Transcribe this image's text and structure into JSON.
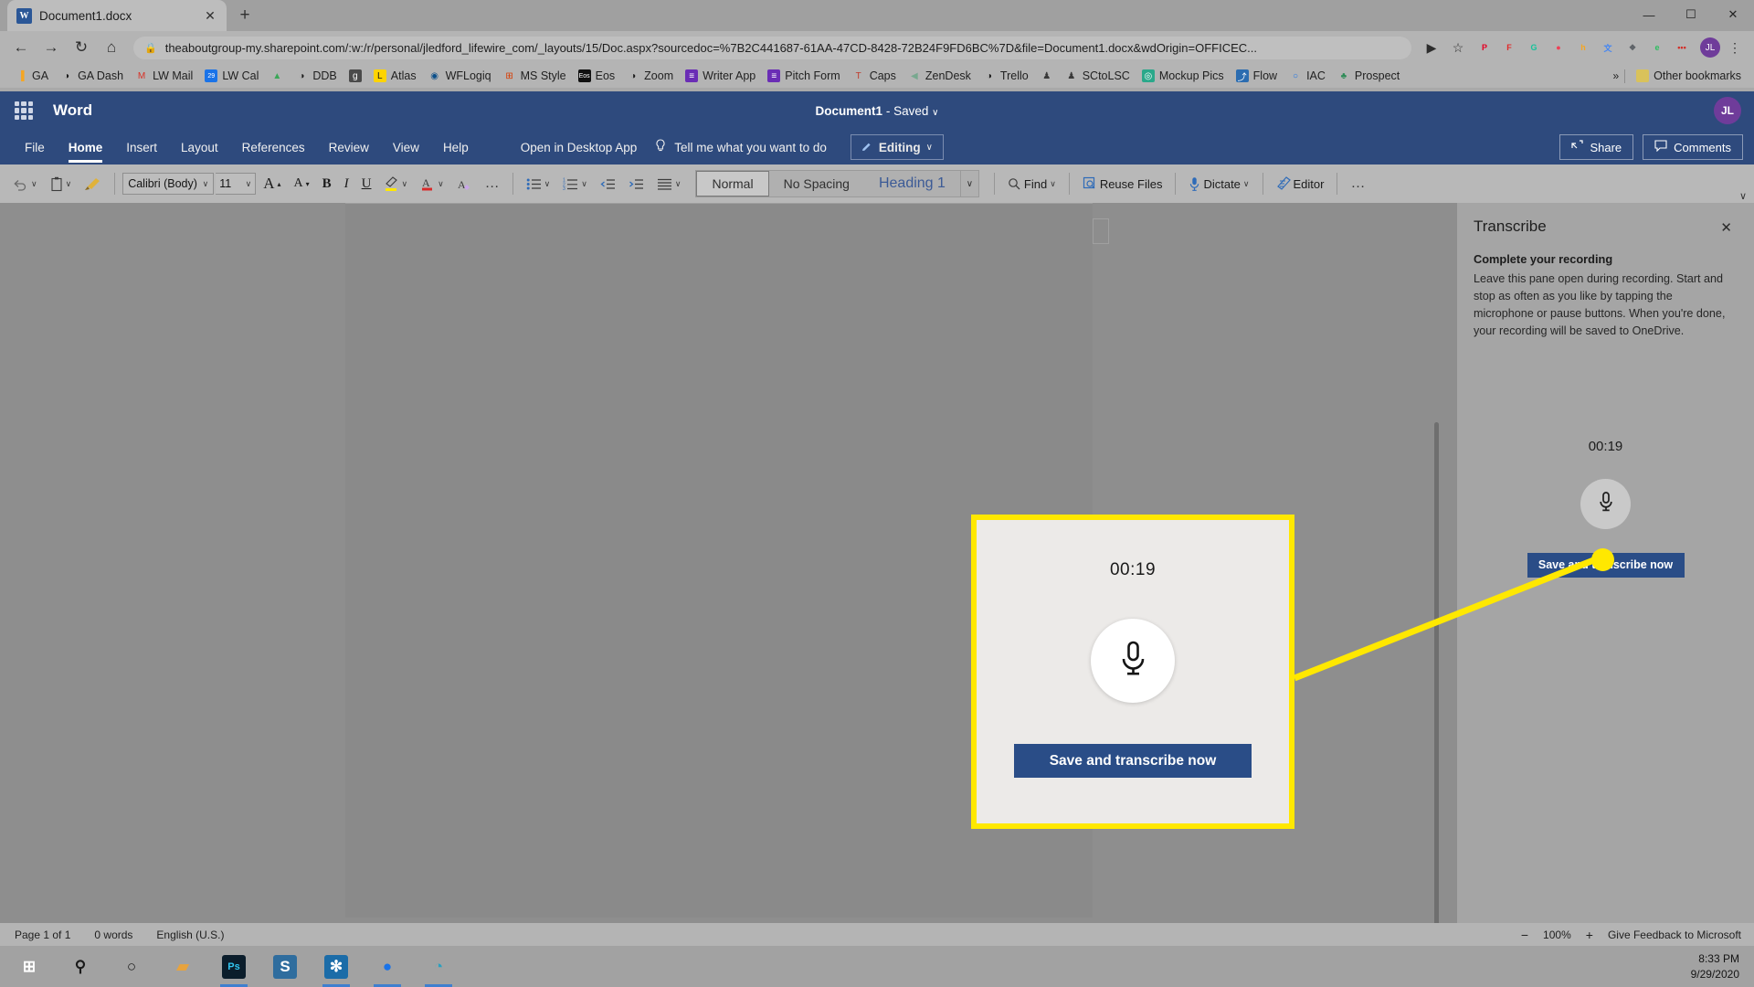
{
  "browser": {
    "tab": {
      "title": "Document1.docx",
      "favicon_label": "W",
      "favicon_name": "word-favicon",
      "close_label": "✕"
    },
    "newtab_label": "+",
    "window_controls": {
      "minimize": "—",
      "maximize": "☐",
      "close": "✕"
    },
    "nav": {
      "back": "←",
      "forward": "→",
      "reload": "↻",
      "home": "⌂"
    },
    "omnibox": {
      "lock": "🔒",
      "url": "theaboutgroup-my.sharepoint.com/:w:/r/personal/jledford_lifewire_com/_layouts/15/Doc.aspx?sourcedoc=%7B2C441687-61AA-47CD-8428-72B24F9FD6BC%7D&file=Document1.docx&wdOrigin=OFFICEC...",
      "media_icon": "▶",
      "star_icon": "☆"
    },
    "extensions": [
      {
        "name": "pinterest-extension",
        "glyph": "P",
        "color": "#e60023"
      },
      {
        "name": "flipboard-extension",
        "glyph": "F",
        "color": "#e12828"
      },
      {
        "name": "grammarly-extension",
        "glyph": "G",
        "color": "#15c39a"
      },
      {
        "name": "pocket-extension",
        "glyph": "●",
        "color": "#ef4056"
      },
      {
        "name": "honey-extension",
        "glyph": "h",
        "color": "#f5a623"
      },
      {
        "name": "translate-extension",
        "glyph": "文",
        "color": "#4285f4"
      },
      {
        "name": "puzzle-extension",
        "glyph": "❖",
        "color": "#5f6368"
      },
      {
        "name": "evernote-extension",
        "glyph": "e",
        "color": "#2dbe60"
      },
      {
        "name": "lastpass-extension",
        "glyph": "•••",
        "color": "#d32d27"
      }
    ],
    "profile_initials": "JL",
    "menu_icon": "⋮",
    "bookmarks": [
      {
        "label": "GA",
        "icon": "bar-chart-icon",
        "glyph": "▐",
        "color": "#f5a623",
        "bg": "transparent"
      },
      {
        "label": "GA Dash",
        "icon": "globe-icon",
        "glyph": "◑",
        "color": "#1a1a1a",
        "bg": "transparent"
      },
      {
        "label": "LW Mail",
        "icon": "gmail-icon",
        "glyph": "M",
        "color": "#d93025",
        "bg": "transparent"
      },
      {
        "label": "LW Cal",
        "icon": "calendar-icon",
        "glyph": "29",
        "color": "#ffffff",
        "bg": "#1a73e8"
      },
      {
        "label": "",
        "icon": "google-drive-icon",
        "glyph": "▲",
        "color": "#3aa757",
        "bg": "transparent"
      },
      {
        "label": "DDB",
        "icon": "globe-icon",
        "glyph": "◑",
        "color": "#1a1a1a",
        "bg": "transparent"
      },
      {
        "label": "",
        "icon": "g-square-icon",
        "glyph": "g",
        "color": "#ffffff",
        "bg": "#4a4a4a"
      },
      {
        "label": "Atlas",
        "icon": "atlas-icon",
        "glyph": "L",
        "color": "#1a1a1a",
        "bg": "#ffd400"
      },
      {
        "label": "WFLogiq",
        "icon": "wflogiq-icon",
        "glyph": "◉",
        "color": "#0b4f8a",
        "bg": "transparent"
      },
      {
        "label": "MS Style",
        "icon": "microsoft-icon",
        "glyph": "⊞",
        "color": "#d83b01",
        "bg": "transparent"
      },
      {
        "label": "Eos",
        "icon": "eos-icon",
        "glyph": "Eos",
        "color": "#ffffff",
        "bg": "#111111"
      },
      {
        "label": "Zoom",
        "icon": "globe-icon",
        "glyph": "◑",
        "color": "#1a1a1a",
        "bg": "transparent"
      },
      {
        "label": "Writer App",
        "icon": "list-icon",
        "glyph": "≡",
        "color": "#ffffff",
        "bg": "#6a2db5"
      },
      {
        "label": "Pitch Form",
        "icon": "list-icon",
        "glyph": "≡",
        "color": "#ffffff",
        "bg": "#6a2db5"
      },
      {
        "label": "Caps",
        "icon": "t-box-icon",
        "glyph": "T",
        "color": "#c0392b",
        "bg": "transparent"
      },
      {
        "label": "ZenDesk",
        "icon": "zendesk-icon",
        "glyph": "◀",
        "color": "#78a88f",
        "bg": "transparent"
      },
      {
        "label": "Trello",
        "icon": "globe-icon",
        "glyph": "◑",
        "color": "#1a1a1a",
        "bg": "transparent"
      },
      {
        "label": "",
        "icon": "person-icon",
        "glyph": "♟",
        "color": "#3a3a3a",
        "bg": "transparent"
      },
      {
        "label": "SCtoLSC",
        "icon": "person-icon",
        "glyph": "♟",
        "color": "#3a3a3a",
        "bg": "transparent"
      },
      {
        "label": "Mockup Pics",
        "icon": "camera-icon",
        "glyph": "◎",
        "color": "#ffffff",
        "bg": "#2aa88a"
      },
      {
        "label": "Flow",
        "icon": "flow-icon",
        "glyph": "⤴",
        "color": "#ffffff",
        "bg": "#2b6cb0"
      },
      {
        "label": "IAC",
        "icon": "circle-icon",
        "glyph": "○",
        "color": "#1a73e8",
        "bg": "transparent"
      },
      {
        "label": "Prospect",
        "icon": "prospect-icon",
        "glyph": "♣",
        "color": "#2e8b57",
        "bg": "transparent"
      }
    ],
    "bookmarks_overflow": "»",
    "other_bookmarks": {
      "label": "Other bookmarks",
      "icon": "folder-icon",
      "glyph": "▮"
    }
  },
  "word": {
    "waffle_name": "app-launcher-icon",
    "brand": "Word",
    "document_title": "Document1",
    "save_state": "Saved",
    "title_dash": "-",
    "title_caret": "∨",
    "avatar_initials": "JL",
    "menu": [
      {
        "label": "File",
        "active": false
      },
      {
        "label": "Home",
        "active": true
      },
      {
        "label": "Insert",
        "active": false
      },
      {
        "label": "Layout",
        "active": false
      },
      {
        "label": "References",
        "active": false
      },
      {
        "label": "Review",
        "active": false
      },
      {
        "label": "View",
        "active": false
      },
      {
        "label": "Help",
        "active": false
      }
    ],
    "open_desktop": "Open in Desktop App",
    "tellme": {
      "label": "Tell me what you want to do",
      "icon": "lightbulb-icon",
      "glyph": "○"
    },
    "editing": {
      "label": "Editing",
      "icon": "pencil-icon",
      "glyph": "✐",
      "caret": "∨"
    },
    "share": {
      "label": "Share",
      "icon": "share-icon",
      "glyph": "⇪"
    },
    "comments": {
      "label": "Comments",
      "icon": "comment-icon",
      "glyph": "▭"
    },
    "ribbon": {
      "undo": {
        "name": "undo-button",
        "glyph": "↶",
        "caret": "∨"
      },
      "paste": {
        "name": "paste-button",
        "glyph": "▧",
        "caret": "∨"
      },
      "format_painter": {
        "name": "format-painter-button",
        "glyph": "✐"
      },
      "font_name": "Calibri (Body)",
      "font_size": "11",
      "grow_font": {
        "name": "grow-font-button",
        "glyph": "A"
      },
      "shrink_font": {
        "name": "shrink-font-button",
        "glyph": "A"
      },
      "bold": "B",
      "italic": "I",
      "underline": "U",
      "highlight": {
        "name": "highlight-color-button",
        "glyph": "✐",
        "caret": "∨",
        "color": "#ffe800"
      },
      "font_color": {
        "name": "font-color-button",
        "glyph": "A",
        "caret": "∨",
        "color": "#d92b2b"
      },
      "clear_format": {
        "name": "clear-formatting-button",
        "glyph": "A"
      },
      "more_font": "…",
      "bullets": {
        "name": "bullet-list-button",
        "glyph": "≣",
        "caret": "∨"
      },
      "numbering": {
        "name": "numbered-list-button",
        "glyph": "≣",
        "caret": "∨"
      },
      "decrease_indent": {
        "name": "decrease-indent-button",
        "glyph": "⤇"
      },
      "increase_indent": {
        "name": "increase-indent-button",
        "glyph": "⤆"
      },
      "align": {
        "name": "align-button",
        "glyph": "≡",
        "caret": "∨"
      },
      "styles": [
        {
          "label": "Normal",
          "selected": true
        },
        {
          "label": "No Spacing",
          "selected": false
        },
        {
          "label": "Heading 1",
          "selected": false
        }
      ],
      "styles_more": "∨",
      "find": {
        "label": "Find",
        "icon": "search-icon",
        "glyph": "⚲",
        "caret": "∨"
      },
      "reuse_files": {
        "label": "Reuse Files",
        "icon": "reuse-files-icon",
        "glyph": "⧉"
      },
      "dictate": {
        "label": "Dictate",
        "icon": "microphone-icon",
        "caret": "∨"
      },
      "editor": {
        "label": "Editor",
        "icon": "editor-icon",
        "glyph": "✒"
      },
      "overflow": "…",
      "collapse": "∨"
    },
    "status": {
      "page": "Page 1 of 1",
      "words": "0 words",
      "language": "English (U.S.)",
      "zoom_out": "−",
      "zoom_level": "100%",
      "zoom_in": "+",
      "feedback": "Give Feedback to Microsoft"
    }
  },
  "transcribe_pane": {
    "title": "Transcribe",
    "close": "✕",
    "subtitle": "Complete your recording",
    "body": "Leave this pane open during recording. Start and stop as often as you like by tapping the microphone or pause buttons. When you're done, your recording will be saved to OneDrive.",
    "timer": "00:19",
    "mic_icon": "microphone-icon",
    "cta": "Save and transcribe now"
  },
  "callout": {
    "timer": "00:19",
    "mic_icon": "microphone-icon",
    "cta": "Save and transcribe now",
    "border_color": "#ffe800"
  },
  "taskbar": {
    "items": [
      {
        "name": "start-button",
        "glyph": "⊞",
        "color": "#ffffff",
        "bg": "transparent",
        "running": false
      },
      {
        "name": "search-icon",
        "glyph": "⚲",
        "color": "#1a1a1a",
        "bg": "transparent",
        "running": false
      },
      {
        "name": "cortana-icon",
        "glyph": "○",
        "color": "#1a1a1a",
        "bg": "transparent",
        "running": false
      },
      {
        "name": "file-explorer-icon",
        "glyph": "▰",
        "color": "#e8a33d",
        "bg": "transparent",
        "running": false
      },
      {
        "name": "photoshop-icon",
        "glyph": "Ps",
        "color": "#31c5f0",
        "bg": "#0b1d2b",
        "running": true
      },
      {
        "name": "snagit-icon",
        "glyph": "S",
        "color": "#ffffff",
        "bg": "#2f6d9e",
        "running": false
      },
      {
        "name": "slack-icon",
        "glyph": "✻",
        "color": "#ffffff",
        "bg": "#1b6ca8",
        "running": true
      },
      {
        "name": "chrome-icon",
        "glyph": "●",
        "color": "#1a73e8",
        "bg": "transparent",
        "running": true
      },
      {
        "name": "edge-icon",
        "glyph": "◔",
        "color": "#2aa0c0",
        "bg": "transparent",
        "running": true
      }
    ],
    "time": "8:33 PM",
    "date": "9/29/2020"
  }
}
